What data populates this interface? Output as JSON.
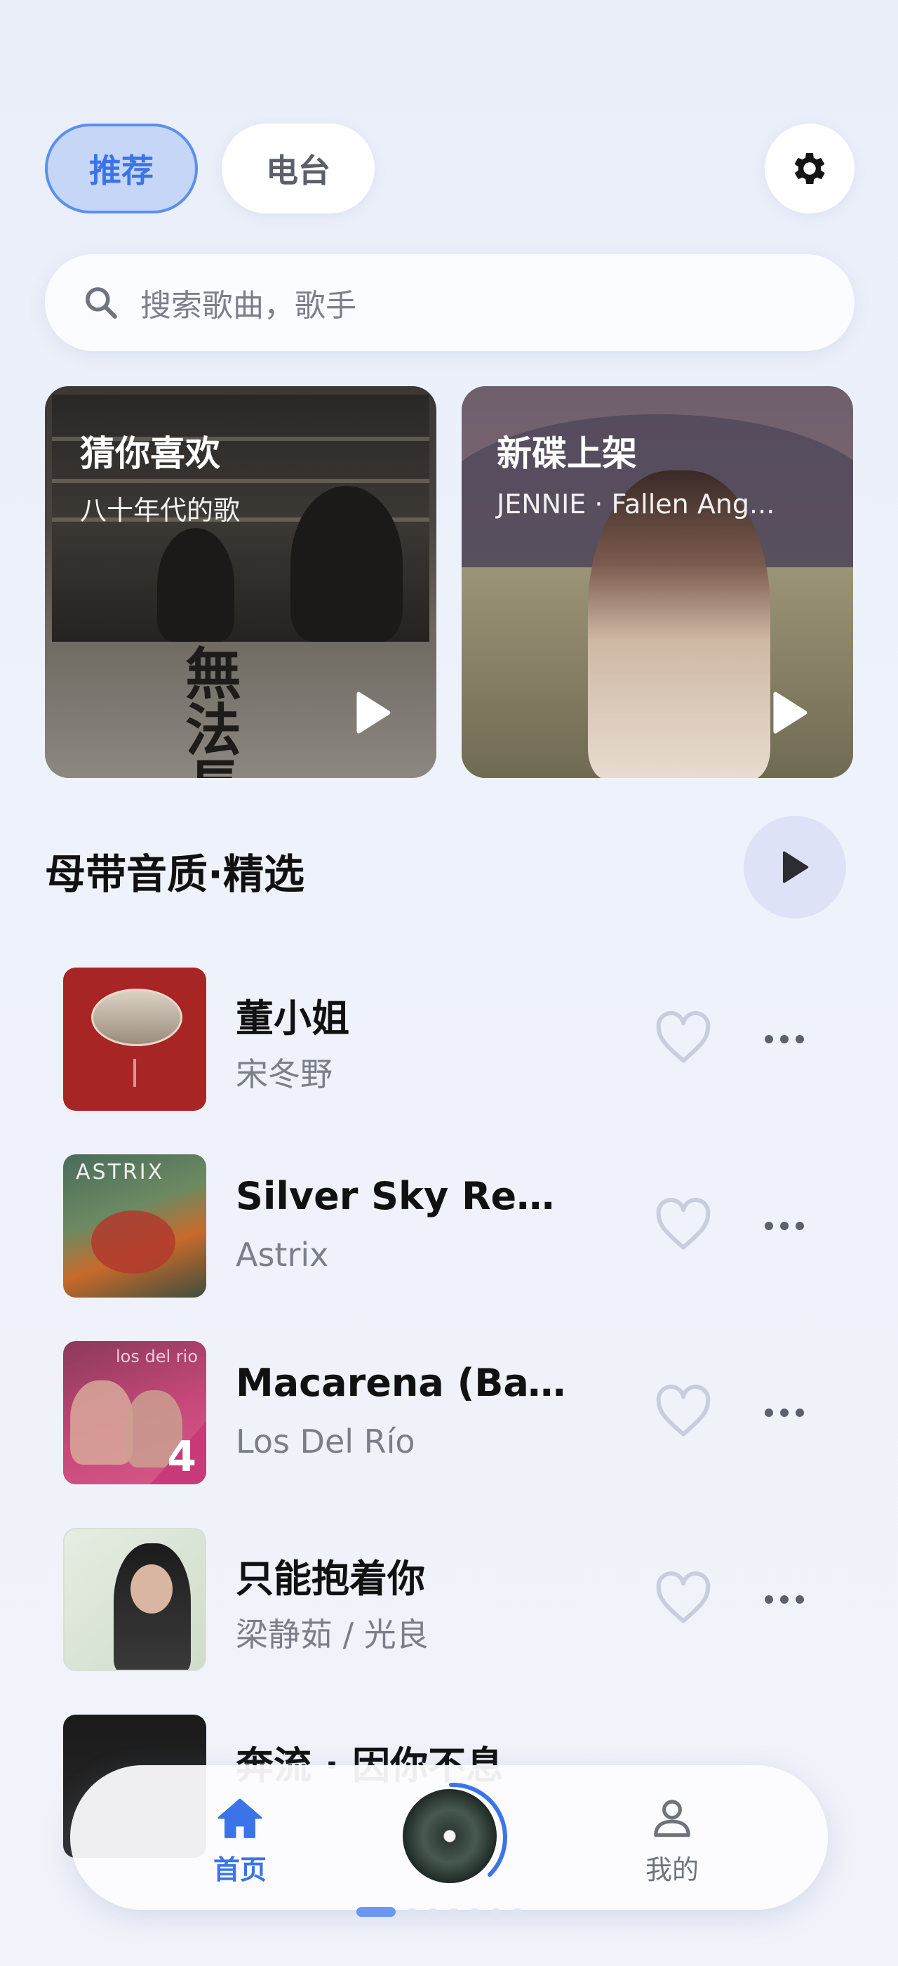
{
  "tabs": [
    {
      "label": "推荐",
      "active": true
    },
    {
      "label": "电台",
      "active": false
    }
  ],
  "search": {
    "placeholder": "搜索歌曲，歌手"
  },
  "features": [
    {
      "title": "猜你喜欢",
      "subtitle": "八十年代的歌",
      "cover_text": "無法長大"
    },
    {
      "title": "新碟上架",
      "subtitle": "JENNIE · Fallen Ang..."
    }
  ],
  "section": {
    "title": "母带音质·精选"
  },
  "songs": [
    {
      "title": "董小姐",
      "artist": "宋冬野"
    },
    {
      "title": "Silver Sky Remix",
      "artist": "Astrix",
      "cover_text": "ASTRIX"
    },
    {
      "title": "Macarena (Baysi...",
      "artist": "Los Del Río",
      "cover_text": "los del rio",
      "cover_number": "4"
    },
    {
      "title": "只能抱着你",
      "artist": "梁静茹 / 光良"
    },
    {
      "title": "奔流 · 因你不息",
      "artist": ""
    }
  ],
  "nav": {
    "home_label": "首页",
    "mine_label": "我的"
  },
  "colors": {
    "accent": "#3a74e8",
    "active_tab_bg": "#c6d6f6",
    "page_bg": "#eef2fb"
  },
  "icons": [
    "settings-gear-icon",
    "search-icon",
    "play-icon",
    "heart-icon",
    "more-icon",
    "home-icon",
    "user-icon"
  ]
}
